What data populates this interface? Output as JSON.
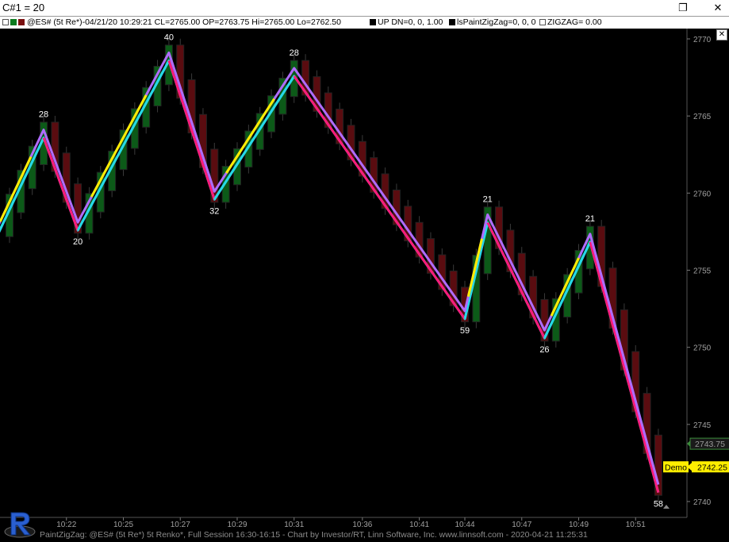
{
  "window": {
    "title": "C#1 = 20",
    "restore_icon": "restore-icon",
    "close_icon": "close-icon"
  },
  "infobar": {
    "symbol": "@ES# (5t Re*)-04/21/20 10:29:21 CL=2765.00 OP=2763.75 Hi=2765.00 Lo=2762.50",
    "study1": "UP DN=0, 0, 1.00",
    "study2": "lsPaintZigZag=0, 0, 0",
    "study3": "ZIGZAG= 0.00",
    "up_color": "#0b7a1e",
    "down_color": "#7a1010"
  },
  "chart_data": {
    "type": "candlestick",
    "ylim": [
      2739,
      2772
    ],
    "yticks": [
      2740,
      2745,
      2750,
      2755,
      2760,
      2765,
      2770
    ],
    "xticks": [
      "10:22",
      "10:25",
      "10:27",
      "10:29",
      "10:31",
      "10:36",
      "10:41",
      "10:44",
      "10:47",
      "10:49",
      "10:51"
    ],
    "bar_count": 58,
    "pivot_labels": [
      {
        "bar": 4,
        "price": 2764,
        "text": "28",
        "pos": "above"
      },
      {
        "bar": 7,
        "price": 2758,
        "text": "20",
        "pos": "below"
      },
      {
        "bar": 15,
        "price": 2769,
        "text": "40",
        "pos": "above"
      },
      {
        "bar": 19,
        "price": 2760,
        "text": "32",
        "pos": "below"
      },
      {
        "bar": 26,
        "price": 2768,
        "text": "28",
        "pos": "above"
      },
      {
        "bar": 41,
        "price": 2752.25,
        "text": "59",
        "pos": "below"
      },
      {
        "bar": 43,
        "price": 2758.5,
        "text": "21",
        "pos": "above"
      },
      {
        "bar": 48,
        "price": 2751,
        "text": "26",
        "pos": "below"
      },
      {
        "bar": 52,
        "price": 2757.25,
        "text": "21",
        "pos": "above"
      },
      {
        "bar": 58,
        "price": 2741,
        "text": "58",
        "pos": "below"
      }
    ],
    "last_price_label": "2743.75",
    "demo_price_label": "2742.25",
    "demo_text": "Demo"
  },
  "footer": {
    "text": "PaintZigZag: @ES# (5t Re*) 5t Renko*, Full Session 16:30-16:15 - Chart by Investor/RT, Linn Software, Inc. www.linnsoft.com - 2020-04-21 11:25:31"
  },
  "colors": {
    "zigzag_purple": "#b06cff",
    "zigzag_cyan": "#26d9e6",
    "zigzag_pink": "#ff1a7a",
    "zigzag_yellow": "#ffee00",
    "candle_up": "#0c5a18",
    "candle_down": "#5a0c10",
    "axis_text": "#a0a0a0",
    "demo_bg": "#ffee00"
  }
}
